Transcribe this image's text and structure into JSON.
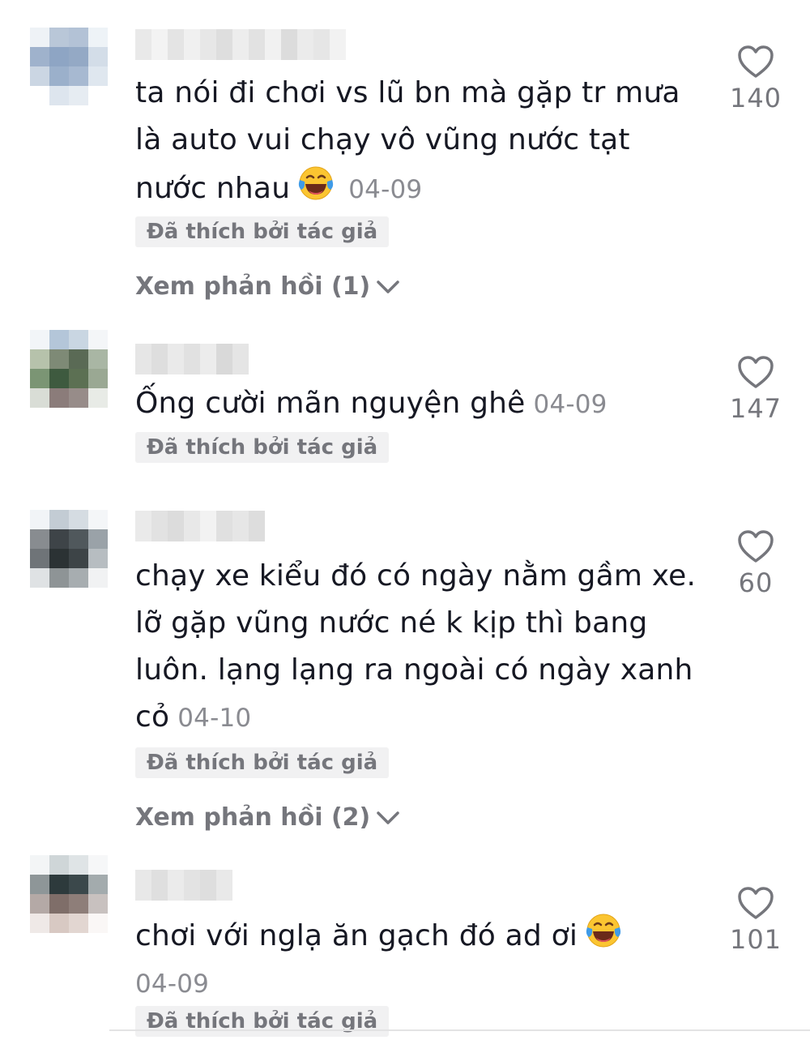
{
  "comments": [
    {
      "text_lines": [
        "ta nói đi chơi vs lũ bn mà gặp tr mưa",
        "là auto vui chạy vô vũng nước tạt",
        "nước nhau"
      ],
      "date": "04-09",
      "liked_by_author": "Đã thích bởi tác giả",
      "view_replies": "Xem phản hồi (1)",
      "likes": "140"
    },
    {
      "text_lines": [
        "Ống cười mãn nguyện ghê"
      ],
      "date": "04-09",
      "liked_by_author": "Đã thích bởi tác giả",
      "likes": "147"
    },
    {
      "text_lines": [
        "chạy xe kiểu đó có ngày nằm gầm xe.",
        "lỡ gặp vũng nước né k kịp thì bang",
        "luôn. lạng lạng ra ngoài có ngày xanh",
        "cỏ"
      ],
      "date": "04-10",
      "liked_by_author": "Đã thích bởi tác giả",
      "view_replies": "Xem phản hồi (2)",
      "likes": "60"
    },
    {
      "text_lines": [
        "chơi với nglạ ăn gạch đó ad ơi"
      ],
      "date": "04-09",
      "liked_by_author": "Đã thích bởi tác giả",
      "likes": "101"
    }
  ],
  "icons": {
    "like": "heart-outline-icon",
    "expand": "chevron-down-icon",
    "emoji": "laughing-tears-emoji"
  },
  "colors": {
    "text": "#161823",
    "muted": "#8a8b91",
    "badge_bg": "#f1f1f2"
  }
}
